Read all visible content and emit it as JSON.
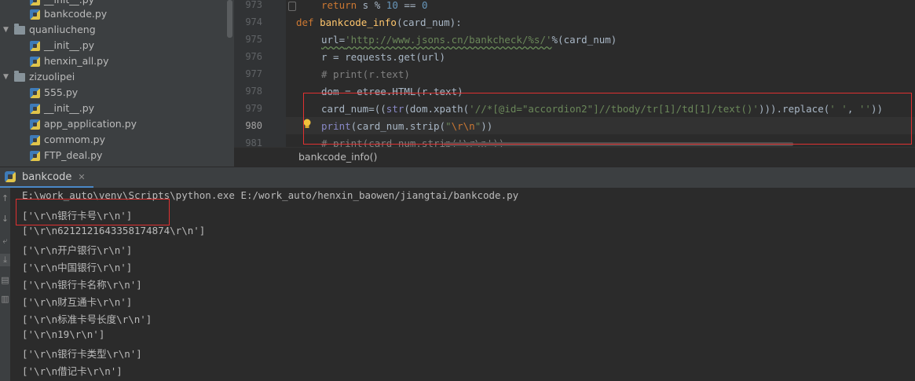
{
  "project_tree": {
    "items": [
      {
        "label": "__init__.py",
        "type": "file",
        "icon": "python-file-icon"
      },
      {
        "label": "bankcode.py",
        "type": "file",
        "icon": "python-file-icon"
      },
      {
        "label": "quanliucheng",
        "type": "folder",
        "icon": "folder-icon"
      },
      {
        "label": "__init__.py",
        "type": "file",
        "icon": "python-file-icon"
      },
      {
        "label": "henxin_all.py",
        "type": "file",
        "icon": "python-file-icon"
      },
      {
        "label": "zizuolipei",
        "type": "folder",
        "icon": "folder-icon"
      },
      {
        "label": "555.py",
        "type": "file",
        "icon": "python-file-icon"
      },
      {
        "label": "__init__.py",
        "type": "file",
        "icon": "python-file-icon"
      },
      {
        "label": "app_application.py",
        "type": "file",
        "icon": "python-file-icon"
      },
      {
        "label": "commom.py",
        "type": "file",
        "icon": "python-file-icon"
      },
      {
        "label": "FTP_deal.py",
        "type": "file",
        "icon": "python-file-icon"
      }
    ]
  },
  "editor": {
    "line_numbers": [
      "973",
      "974",
      "975",
      "976",
      "977",
      "978",
      "979",
      "980",
      "981"
    ],
    "current_line": "980",
    "code": {
      "l973_kw": "return",
      "l973_rest": " s % ",
      "l973_n1": "10",
      "l973_eq": " == ",
      "l973_n2": "0",
      "l974_kw": "def",
      "l974_fn": "bankcode_info",
      "l974_rest": "(card_num):",
      "l975_a": "url=",
      "l975_str": "'http://www.jsons.cn/bankcheck/%s/'",
      "l975_b": "%(card_num)",
      "l976": "r = requests.get(url)",
      "l977": "# print(r.text)",
      "l978": "dom = etree.HTML(r.text)",
      "l979_a": "card_num=((",
      "l979_bi": "str",
      "l979_b": "(dom.xpath(",
      "l979_str": "'//*[@id=\"accordion2\"]//tbody/tr[1]/td[1]/text()'",
      "l979_c": "))).replace(",
      "l979_str2": "' '",
      "l979_d": ", ",
      "l979_str3": "''",
      "l979_e": "))",
      "l980_bi": "print",
      "l980_a": "(card_num.strip(",
      "l980_q1": "\"",
      "l980_esc": "\\r\\n",
      "l980_q2": "\"",
      "l980_b": "))",
      "l981": "# print(card_num.strip('\\r\\n'))"
    },
    "breadcrumb": "bankcode_info()"
  },
  "run_panel": {
    "tab_label": "bankcode",
    "toolbar_icons": [
      "rerun-icon",
      "stop-icon",
      "soft-wrap-icon",
      "scroll-to-end-icon",
      "print-icon",
      "trash-icon"
    ],
    "output": [
      "E:\\work_auto\\venv\\Scripts\\python.exe E:/work_auto/henxin_baowen/jiangtai/bankcode.py",
      "['\\r\\n银行卡号\\r\\n']",
      "['\\r\\n6212121643358174874\\r\\n']",
      "['\\r\\n开户银行\\r\\n']",
      "['\\r\\n中国银行\\r\\n']",
      "['\\r\\n银行卡名称\\r\\n']",
      "['\\r\\n财互通卡\\r\\n']",
      "['\\r\\n标准卡号长度\\r\\n']",
      "['\\r\\n19\\r\\n']",
      "['\\r\\n银行卡类型\\r\\n']",
      "['\\r\\n借记卡\\r\\n']"
    ]
  },
  "colors": {
    "annotation_red": "#e03131",
    "keyword": "#cc7832",
    "function": "#ffc66d",
    "string": "#6a8759",
    "number": "#6897bb"
  }
}
